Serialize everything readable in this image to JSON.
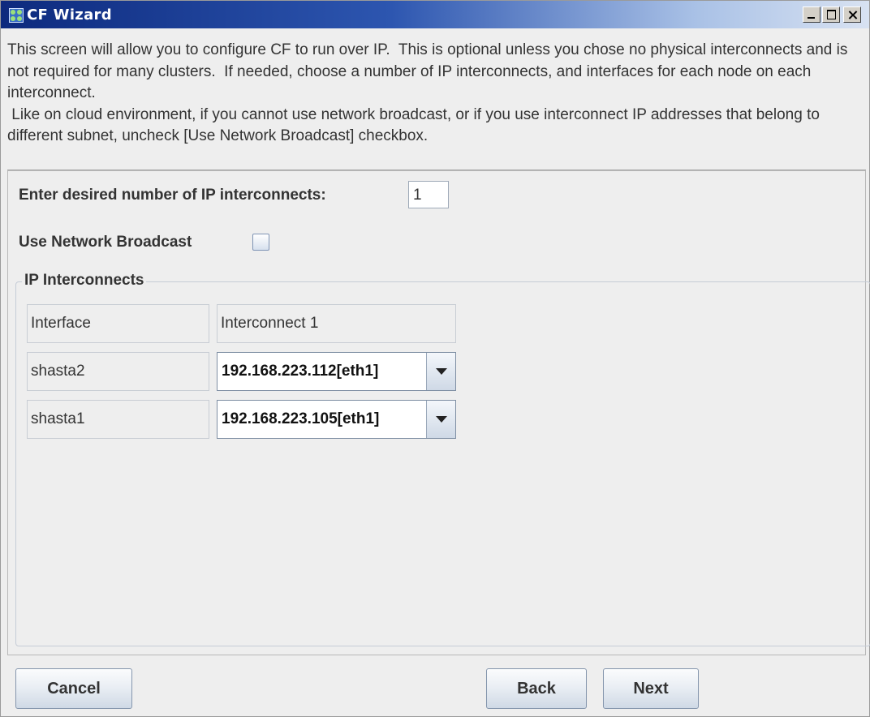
{
  "window": {
    "title": "CF Wizard",
    "icon": "cf-wizard-app-icon",
    "controls": [
      "minimize-icon",
      "maximize-icon",
      "close-icon"
    ]
  },
  "description": [
    "This screen will allow you to configure CF to run over IP.  This is optional unless you chose no physical interconnects and is not required for many clusters.  If needed, choose a number of IP interconnects, and interfaces for each node on each interconnect.",
    " Like on cloud environment, if you cannot use network broadcast, or if you use interconnect IP addresses that belong to different subnet, uncheck [Use Network Broadcast] checkbox."
  ],
  "form": {
    "interconnect_count_label": "Enter desired number of IP interconnects:",
    "interconnect_count_value": "1",
    "broadcast_label": "Use Network Broadcast",
    "broadcast_checked": false
  },
  "interconnects": {
    "group_title": "IP Interconnects",
    "header": {
      "interface": "Interface",
      "interconnect": "Interconnect 1"
    },
    "rows": [
      {
        "node": "shasta2",
        "value": "192.168.223.112[eth1]"
      },
      {
        "node": "shasta1",
        "value": "192.168.223.105[eth1]"
      }
    ]
  },
  "buttons": {
    "cancel": "Cancel",
    "back": "Back",
    "next": "Next"
  },
  "colors": {
    "titlebar_start": "#0d2a7e",
    "titlebar_end": "#d8e2f2",
    "panel_bg": "#eeeeee"
  }
}
